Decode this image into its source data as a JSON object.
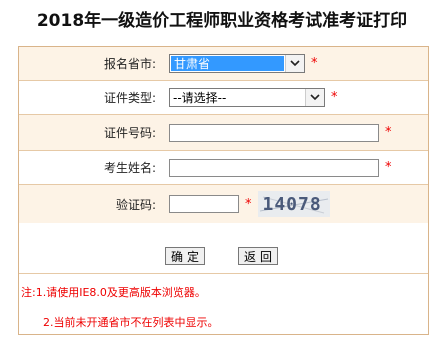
{
  "page": {
    "title": "2018年一级造价工程师职业资格考试准考证打印"
  },
  "form": {
    "province": {
      "label": "报名省市:",
      "value": "甘肃省"
    },
    "id_type": {
      "label": "证件类型:",
      "value": "--请选择--"
    },
    "id_number": {
      "label": "证件号码:",
      "value": ""
    },
    "name": {
      "label": "考生姓名:",
      "value": ""
    },
    "captcha": {
      "label": "验证码:",
      "value": "",
      "image_text": "14078"
    },
    "required_mark": "*"
  },
  "buttons": {
    "confirm": "确定",
    "back": "返回"
  },
  "notes": {
    "prefix": "注:",
    "item1": "1.请使用IE8.0及更高版本浏览器。",
    "item2": "2.当前未开通省市不在列表中显示。"
  },
  "colors": {
    "row_alt": "#fdf3e6",
    "border": "#d9b48a",
    "required": "#ee0000",
    "selected": "#3399ff"
  }
}
